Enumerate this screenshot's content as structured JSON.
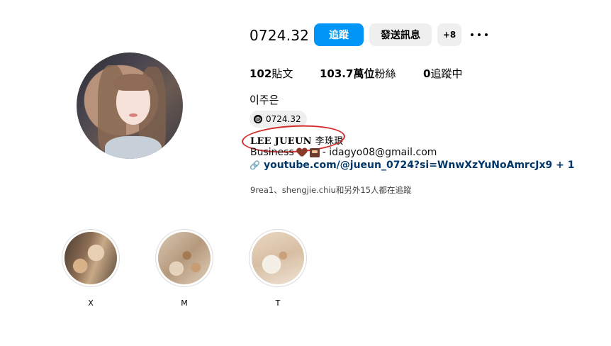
{
  "profile": {
    "username": "0724.32",
    "follow_label": "追蹤",
    "message_label": "發送訊息",
    "add_user_label": "+8",
    "posts_count": "102",
    "posts_label": "貼文",
    "followers_count": "103.7萬位",
    "followers_label": "粉絲",
    "following_count": "0",
    "following_label": "追蹤中",
    "full_name": "이주은",
    "threads_handle": "0724.32",
    "bio_name_latin": "LEE JUEUN",
    "bio_name_cjk": "李珠珢",
    "bio_business": "Business",
    "bio_email": "- idagyo08@gmail.com",
    "link": "youtube.com/@jueun_0724?si=WnwXzYuNoAmrcJx9 + 1",
    "followed_by": "9rea1、shengjie.chiu和另外15人都在追蹤"
  },
  "highlights": [
    {
      "label": "X"
    },
    {
      "label": "M"
    },
    {
      "label": "T"
    }
  ],
  "colors": {
    "follow_button": "#0095f6",
    "secondary_button": "#efefef",
    "link": "#00376b",
    "annotation": "#d32d2d"
  },
  "icons": {
    "threads": "threads-icon",
    "link": "link-icon",
    "more": "more-options-icon"
  }
}
